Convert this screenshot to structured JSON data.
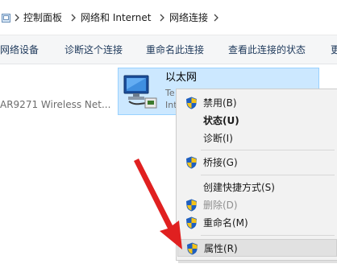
{
  "breadcrumb": {
    "items": [
      "控制面板",
      "网络和 Internet",
      "网络连接"
    ]
  },
  "toolbar": {
    "items": [
      "网络设备",
      "诊断这个连接",
      "重命名此连接",
      "查看此连接的状态",
      "更"
    ]
  },
  "adapters": {
    "left_text": "AR9271 Wireless Net...",
    "ethernet": {
      "name": "以太网",
      "line1": "Te",
      "line2": "Int"
    }
  },
  "context_menu": {
    "items": [
      {
        "label": "禁用(B)",
        "shield": true,
        "bold": false,
        "disabled": false
      },
      {
        "label": "状态(U)",
        "shield": false,
        "bold": true,
        "disabled": false
      },
      {
        "label": "诊断(I)",
        "shield": false,
        "bold": false,
        "disabled": false
      },
      {
        "label": "桥接(G)",
        "shield": true,
        "bold": false,
        "disabled": false
      },
      {
        "label": "创建快捷方式(S)",
        "shield": false,
        "bold": false,
        "disabled": false
      },
      {
        "label": "删除(D)",
        "shield": true,
        "bold": false,
        "disabled": true
      },
      {
        "label": "重命名(M)",
        "shield": true,
        "bold": false,
        "disabled": false
      },
      {
        "label": "属性(R)",
        "shield": true,
        "bold": false,
        "disabled": false,
        "hovered": true
      }
    ]
  },
  "colors": {
    "selection": "#cce8ff",
    "selection_border": "#99d1ff",
    "annotation_arrow": "#e02020",
    "shield_blue": "#1f5fbf",
    "shield_yellow": "#f3c318"
  },
  "icons": {
    "folder": "folder-icon",
    "separator": "chevron-right-icon",
    "adapter": "network-adapter-icon",
    "uac": "uac-shield-icon",
    "annotation": "red-arrow"
  }
}
